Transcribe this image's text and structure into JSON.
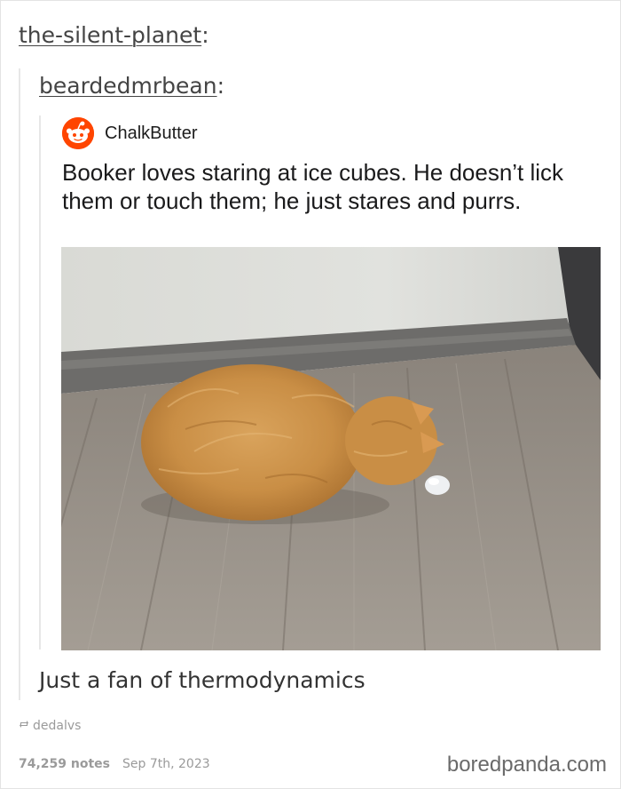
{
  "post": {
    "op_username": "the-silent-planet",
    "reblogger_username": "beardedmrbean",
    "colon": ":",
    "caption": "Just a fan of thermodynamics"
  },
  "embedded_reddit": {
    "username": "ChalkButter",
    "title": "Booker loves staring at ice cubes. He doesn’t lick them or touch them; he just stares and purrs.",
    "avatar_icon": "reddit-snoo-icon",
    "accent_color": "#ff4500"
  },
  "photo": {
    "subject": "orange-cat-staring-at-ice-cube"
  },
  "footer": {
    "reblog_icon": "reblog-icon",
    "reblogged_from": "dedalvs",
    "notes": "74,259 notes",
    "date": "Sep 7th, 2023",
    "watermark": "boredpanda.com"
  }
}
